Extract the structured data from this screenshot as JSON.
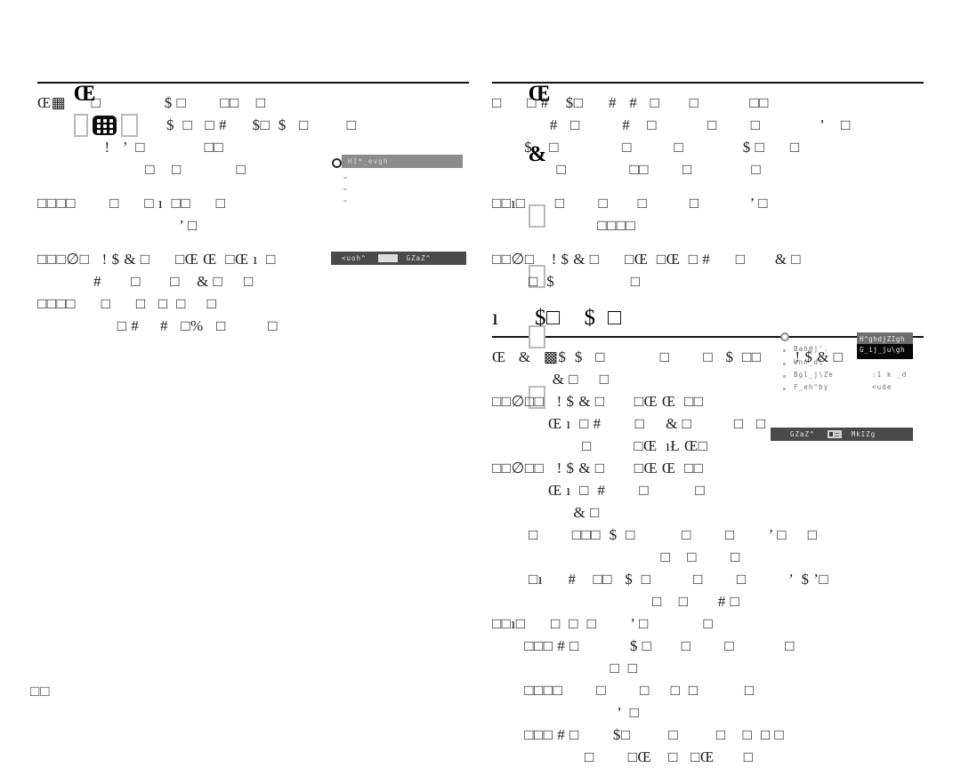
{
  "page": {
    "folio": "□□"
  },
  "left_column": {
    "heading": {
      "lead": "Œ",
      "icons": [
        "tofu-outline",
        "grid-glyph",
        "tofu-outline"
      ]
    },
    "lines": [
      "Œ▦      □               $ □        □□    □",
      "            $  □   □ #      $□  $   □         □",
      "  !   ’  □              □□",
      "       □    □             □",
      "□□□□        □      □ ı  □□      □",
      "               ’ □",
      "□□□∅□   ! $ & □      □Œ Œ  □Œ ı  □",
      "    #       □       □    & □     □",
      "□□□□      □      □   □  □     □",
      "     □ #     #   □%   □          □"
    ],
    "figures": {
      "combo": {
        "bar_text": "HI*_evgh"
      },
      "statusbar": {
        "left_label": "<uoh^",
        "right_label": "GZaZ^"
      }
    }
  },
  "right_column": {
    "heading_top": {
      "lead": "Œ",
      "amp": "&",
      "tofu_dark": "□",
      "tofu_grey": "□ □  □"
    },
    "lines_top": [
      "□      □ #    $□      #   #   □       □            □□",
      "         #   □          #    □            □        □              ’    □",
      "   $    □               □          □              $ □      □",
      "      □               □□        □              □",
      "□□ı□       □        □       □          □            ’ □",
      "           □□□□",
      "□□∅□    ! $ & □      □Œ  □Œ  □ #      □       & □",
      "    □  $                  □"
    ],
    "heading_mid": {
      "text": "ı      $□    $  □"
    },
    "lines_mid": [
      "Œ   &   ▩$  $   □             □        □   $  □□        ! $ & □",
      "     & □     □",
      "□□∅□□   ! $ & □       □Œ Œ  □□",
      "    Œ ı  □ #        □     & □          □   □",
      "            □          □Œ  ıŁ Œ□",
      "□□∅□□   ! $ & □       □Œ Œ  □□",
      "    Œ ı  □  #        □           □",
      "          & □",
      "    □        □□□  $  □           □        □        ’ □     □",
      "                          □    □        □",
      "    □ı      #    □□   $  □          □        □          ’  $ ’□",
      "                        □    □       # □",
      "□□ı□      □  □  □        ’ □             □",
      "   □□□ # □            $ □       □        □            □",
      "              □  □",
      "   □□□□        □        □     □  □           □",
      "           ’  □",
      "   □□□ # □        $□         □         □    □  □ □",
      "        □        □Œ    □   □Œ       □"
    ],
    "figures": {
      "list": {
        "items": [
          {
            "label": "Bah@j'.",
            "value": ""
          },
          {
            "label": "Wnn_dl",
            "value": ""
          },
          {
            "label": "Bgl_j\\Ze",
            "value": ":1 k _d"
          },
          {
            "label": "F_eh^by",
            "value": "<ude"
          }
        ]
      },
      "tooltip": {
        "line1": "H^ghdjZIgh",
        "line2": "G_ij_ju\\gh"
      },
      "statusbar": {
        "left_label": "GZaZ^",
        "right_label": "MkIZg"
      }
    }
  },
  "colors": {
    "text": "#1f1f1f",
    "rule": "#111111",
    "grey_bar": "#8c8c8c",
    "dark_bar": "#4a4a4a",
    "tooltip_bg": "#070707",
    "tooltip_sel": "#6d6d6d"
  }
}
